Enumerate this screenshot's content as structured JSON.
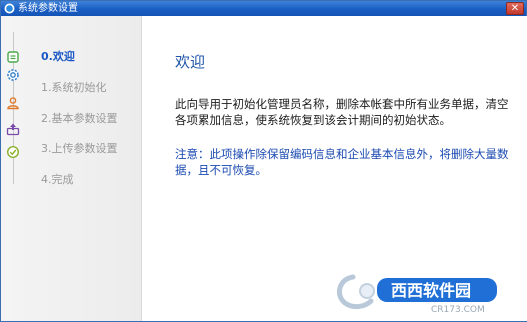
{
  "window": {
    "title": "系统参数设置",
    "close_label": "✕"
  },
  "sidebar": {
    "steps": [
      {
        "label": "0.欢迎",
        "icon": "welcome-icon",
        "active": true
      },
      {
        "label": "1.系统初始化",
        "icon": "gear-icon",
        "active": false
      },
      {
        "label": "2.基本参数设置",
        "icon": "user-icon",
        "active": false
      },
      {
        "label": "3.上传参数设置",
        "icon": "upload-icon",
        "active": false
      },
      {
        "label": "4.完成",
        "icon": "check-icon",
        "active": false
      }
    ]
  },
  "main": {
    "heading": "欢迎",
    "paragraph": "此向导用于初始化管理员名称，删除本帐套中所有业务单据，清空各项累加信息，使系统恢复到该会计期间的初始状态。",
    "note": "注意：此项操作除保留编码信息和企业基本信息外，将删除大量数据，且不可恢复。"
  },
  "watermark": {
    "brand": "西西软件园",
    "domain": "CR173.COM"
  },
  "colors": {
    "titlebar": "#1a5fc4",
    "active_step": "#1a57c4",
    "inactive_step": "#9a9a9a",
    "note": "#1a4ab0"
  }
}
